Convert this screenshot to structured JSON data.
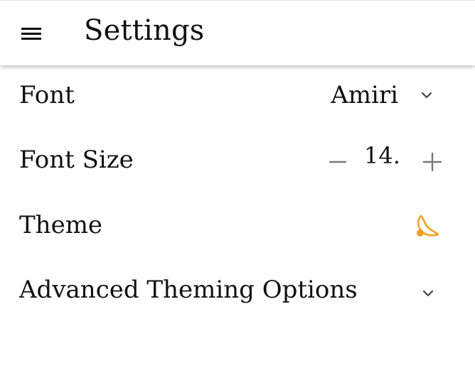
{
  "header": {
    "title": "Settings",
    "menu_icon": "hamburger-menu-icon"
  },
  "settings": {
    "font": {
      "label": "Font",
      "value": "Amiri",
      "dropdown_icon": "chevron-down-icon"
    },
    "font_size": {
      "label": "Font Size",
      "value": "14.",
      "decrement_icon": "minus-icon",
      "increment_icon": "plus-icon"
    },
    "theme": {
      "label": "Theme",
      "icon": "moon-icon",
      "icon_color": "#f0a020"
    },
    "advanced": {
      "label": "Advanced Theming Options",
      "expand_icon": "chevron-down-icon"
    }
  },
  "colors": {
    "background": "#ffffff",
    "text": "#111111",
    "icon_gray": "#666666",
    "accent": "#f0a020"
  }
}
